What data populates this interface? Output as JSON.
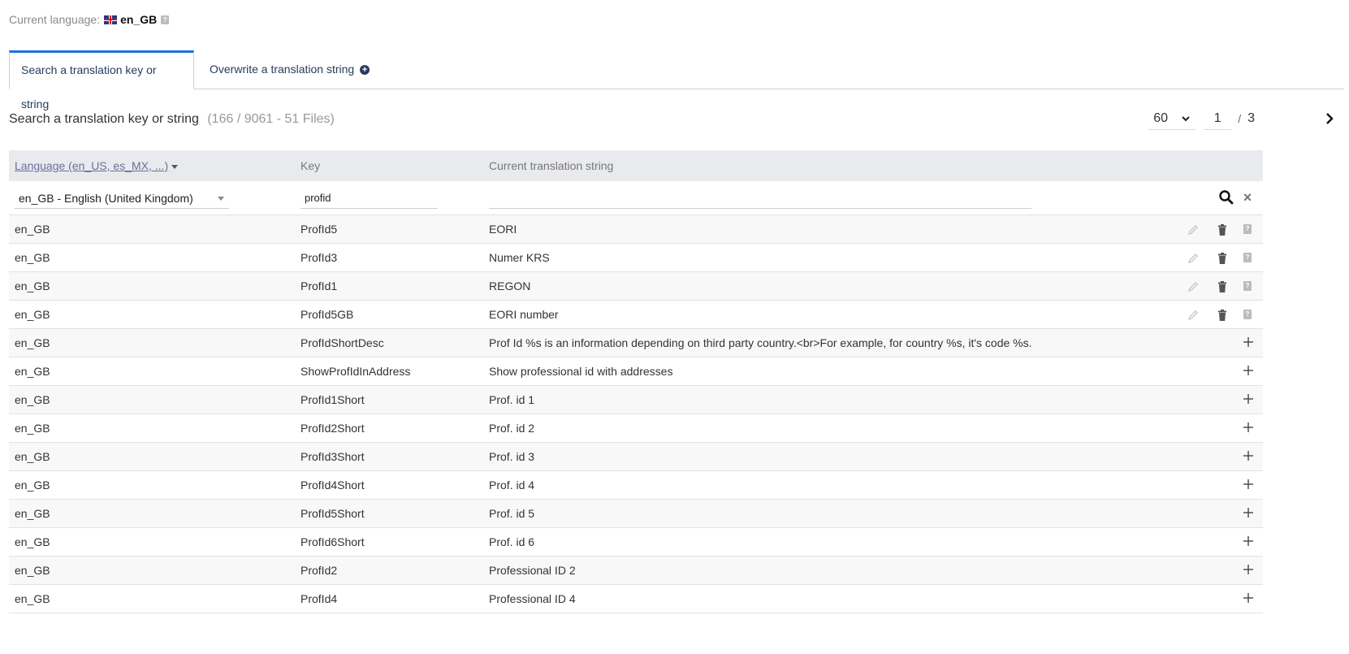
{
  "current_language": {
    "label": "Current language:",
    "code": "en_GB",
    "help": "?"
  },
  "tabs": [
    {
      "label": "Search a translation key or string"
    },
    {
      "label": "Overwrite a translation string"
    }
  ],
  "heading": {
    "title": "Search a translation key or string",
    "counts": "(166 / 9061 - 51 Files)"
  },
  "pager": {
    "page_size": "60",
    "page": "1",
    "separator": "/",
    "total_pages": "3"
  },
  "table": {
    "headers": {
      "language": "Language (en_US, es_MX, ...)",
      "key": "Key",
      "string": "Current translation string"
    },
    "filters": {
      "language": "en_GB - English (United Kingdom)",
      "key": "profid",
      "string": ""
    },
    "rows": [
      {
        "lang": "en_GB",
        "key": "ProfId5",
        "string": "EORI",
        "actions": "edit"
      },
      {
        "lang": "en_GB",
        "key": "ProfId3",
        "string": "Numer KRS",
        "actions": "edit"
      },
      {
        "lang": "en_GB",
        "key": "ProfId1",
        "string": "REGON",
        "actions": "edit"
      },
      {
        "lang": "en_GB",
        "key": "ProfId5GB",
        "string": "EORI number",
        "actions": "edit"
      },
      {
        "lang": "en_GB",
        "key": "ProfIdShortDesc",
        "string": "Prof Id %s is an information depending on third party country.<br>For example, for country %s, it's code %s.",
        "actions": "add"
      },
      {
        "lang": "en_GB",
        "key": "ShowProfIdInAddress",
        "string": "Show professional id with addresses",
        "actions": "add"
      },
      {
        "lang": "en_GB",
        "key": "ProfId1Short",
        "string": "Prof. id 1",
        "actions": "add"
      },
      {
        "lang": "en_GB",
        "key": "ProfId2Short",
        "string": "Prof. id 2",
        "actions": "add"
      },
      {
        "lang": "en_GB",
        "key": "ProfId3Short",
        "string": "Prof. id 3",
        "actions": "add"
      },
      {
        "lang": "en_GB",
        "key": "ProfId4Short",
        "string": "Prof. id 4",
        "actions": "add"
      },
      {
        "lang": "en_GB",
        "key": "ProfId5Short",
        "string": "Prof. id 5",
        "actions": "add"
      },
      {
        "lang": "en_GB",
        "key": "ProfId6Short",
        "string": "Prof. id 6",
        "actions": "add"
      },
      {
        "lang": "en_GB",
        "key": "ProfId2",
        "string": "Professional ID 2",
        "actions": "add"
      },
      {
        "lang": "en_GB",
        "key": "ProfId4",
        "string": "Professional ID 4",
        "actions": "add"
      }
    ]
  },
  "icons": {
    "add": "+",
    "help": "?",
    "clear": "×"
  }
}
